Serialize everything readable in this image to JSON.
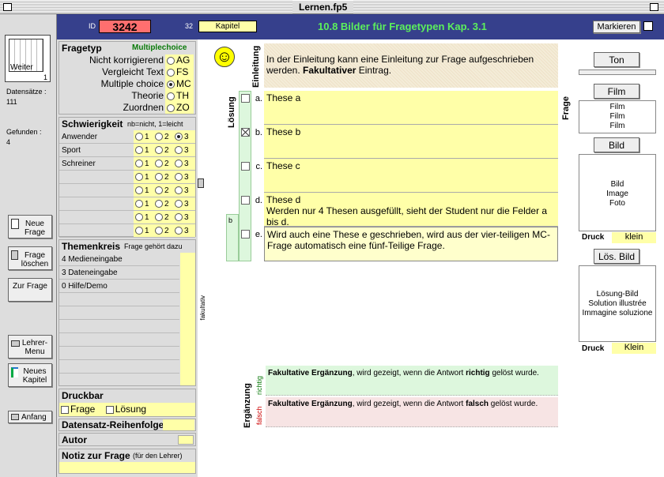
{
  "window": {
    "title": "Lernen.fp5"
  },
  "sidebar": {
    "book_label": "Weiter",
    "book_page": "1",
    "records_label": "Datensätze :",
    "records_value": "111",
    "found_label": "Gefunden :",
    "found_value": "4",
    "buttons": {
      "new_question": "Neue Frage",
      "delete_question": "Frage löschen",
      "to_question": "Zur Frage",
      "teacher_menu": "Lehrer-Menu",
      "new_chapter": "Neues Kapitel",
      "start": "Anfang"
    }
  },
  "header": {
    "id_label": "ID",
    "id_value": "3242",
    "chapter_num": "32",
    "chapter_label": "Kapitel",
    "title": "10.8 Bilder für Fragetypen Kap. 3.1",
    "mark_button": "Markieren"
  },
  "fragetyp": {
    "heading": "Fragetyp",
    "current": "Multiplechoice",
    "options": [
      {
        "label": "Nicht korrigierend",
        "code": "AG",
        "selected": false
      },
      {
        "label": "Vergleicht Text",
        "code": "FS",
        "selected": false
      },
      {
        "label": "Multiple choice",
        "code": "MC",
        "selected": true
      },
      {
        "label": "Theorie",
        "code": "TH",
        "selected": false
      },
      {
        "label": "Zuordnen",
        "code": "ZO",
        "selected": false
      }
    ]
  },
  "schwierigkeit": {
    "heading": "Schwierigkeit",
    "note": "nb=nicht, 1=leicht",
    "rows": [
      {
        "name": "Anwender",
        "selected": 3
      },
      {
        "name": "Sport",
        "selected": 0
      },
      {
        "name": "Schreiner",
        "selected": 0
      },
      {
        "name": "",
        "selected": 0
      },
      {
        "name": "",
        "selected": 0
      },
      {
        "name": "",
        "selected": 0
      },
      {
        "name": "",
        "selected": 0
      },
      {
        "name": "",
        "selected": 0
      }
    ],
    "levels": [
      "1",
      "2",
      "3"
    ]
  },
  "themenkreis": {
    "heading": "Themenkreis",
    "note": "Frage gehört dazu",
    "items": [
      "4 Medieneingabe",
      "3 Dateneingabe",
      "0 Hilfe/Demo",
      "",
      "",
      "",
      "",
      "",
      ""
    ],
    "side_label": "fakultativ"
  },
  "druckbar": {
    "heading": "Druckbar",
    "frage": "Frage",
    "loesung": "Lösung"
  },
  "reihenfolge": {
    "heading": "Datensatz-Reihenfolge"
  },
  "autor": {
    "heading": "Autor"
  },
  "notiz": {
    "heading": "Notiz zur Frage",
    "note": "(für den Lehrer)"
  },
  "main": {
    "smiley": "☺",
    "einleitung_label": "Einleitung",
    "einleitung_text": "In der Einleitung kann eine Einleitung zur Frage aufgeschrieben werden.",
    "einleitung_bold": "Fakultativer",
    "einleitung_end": "Eintrag.",
    "loesung_label": "Lösung",
    "frage_label": "Frage",
    "b_marker": "b",
    "theses": [
      {
        "letter": "a.",
        "text": "These a",
        "checked": false
      },
      {
        "letter": "b.",
        "text": "These b",
        "checked": true
      },
      {
        "letter": "c.",
        "text": "These c",
        "checked": false
      },
      {
        "letter": "d.",
        "text": "These d\nWerden nur 4 Thesen ausgefüllt, sieht der Student nur die Felder a bis d.",
        "checked": false
      },
      {
        "letter": "e.",
        "text": "Wird auch eine These e geschrieben, wird aus der vier-teiligen MC-Frage automatisch eine fünf-Teilige Frage.",
        "checked": false
      }
    ],
    "ergaenzung_label": "Ergänzung",
    "richtig_label": "richtig",
    "falsch_label": "falsch",
    "richtig_bold": "Fakultative Ergänzung",
    "richtig_text1": ", wird gezeigt, wenn die Antwort ",
    "richtig_word": "richtig",
    "richtig_text2": " gelöst wurde.",
    "falsch_bold": "Fakultative Ergänzung",
    "falsch_text1": ", wird gezeigt, wenn die Antwort ",
    "falsch_word": "falsch",
    "falsch_text2": " gelöst wurde."
  },
  "media": {
    "ton": "Ton",
    "film": "Film",
    "film_lines": [
      "Film",
      "Film",
      "Film"
    ],
    "bild": "Bild",
    "bild_lines": [
      "Bild",
      "Image",
      "Foto"
    ],
    "druck_label": "Druck",
    "bild_size": "klein",
    "loes_bild": "Lös. Bild",
    "loes_lines": [
      "Lösung-Bild",
      "Solution illustrée",
      "Immagine soluzione"
    ],
    "loes_size": "Klein"
  },
  "colors": {
    "header": "#36408c",
    "id_field": "#ff6f6f",
    "title": "#5cf05c",
    "field": "#ffffa8",
    "green": "#ddf7dd",
    "pink": "#f7e4e4"
  }
}
